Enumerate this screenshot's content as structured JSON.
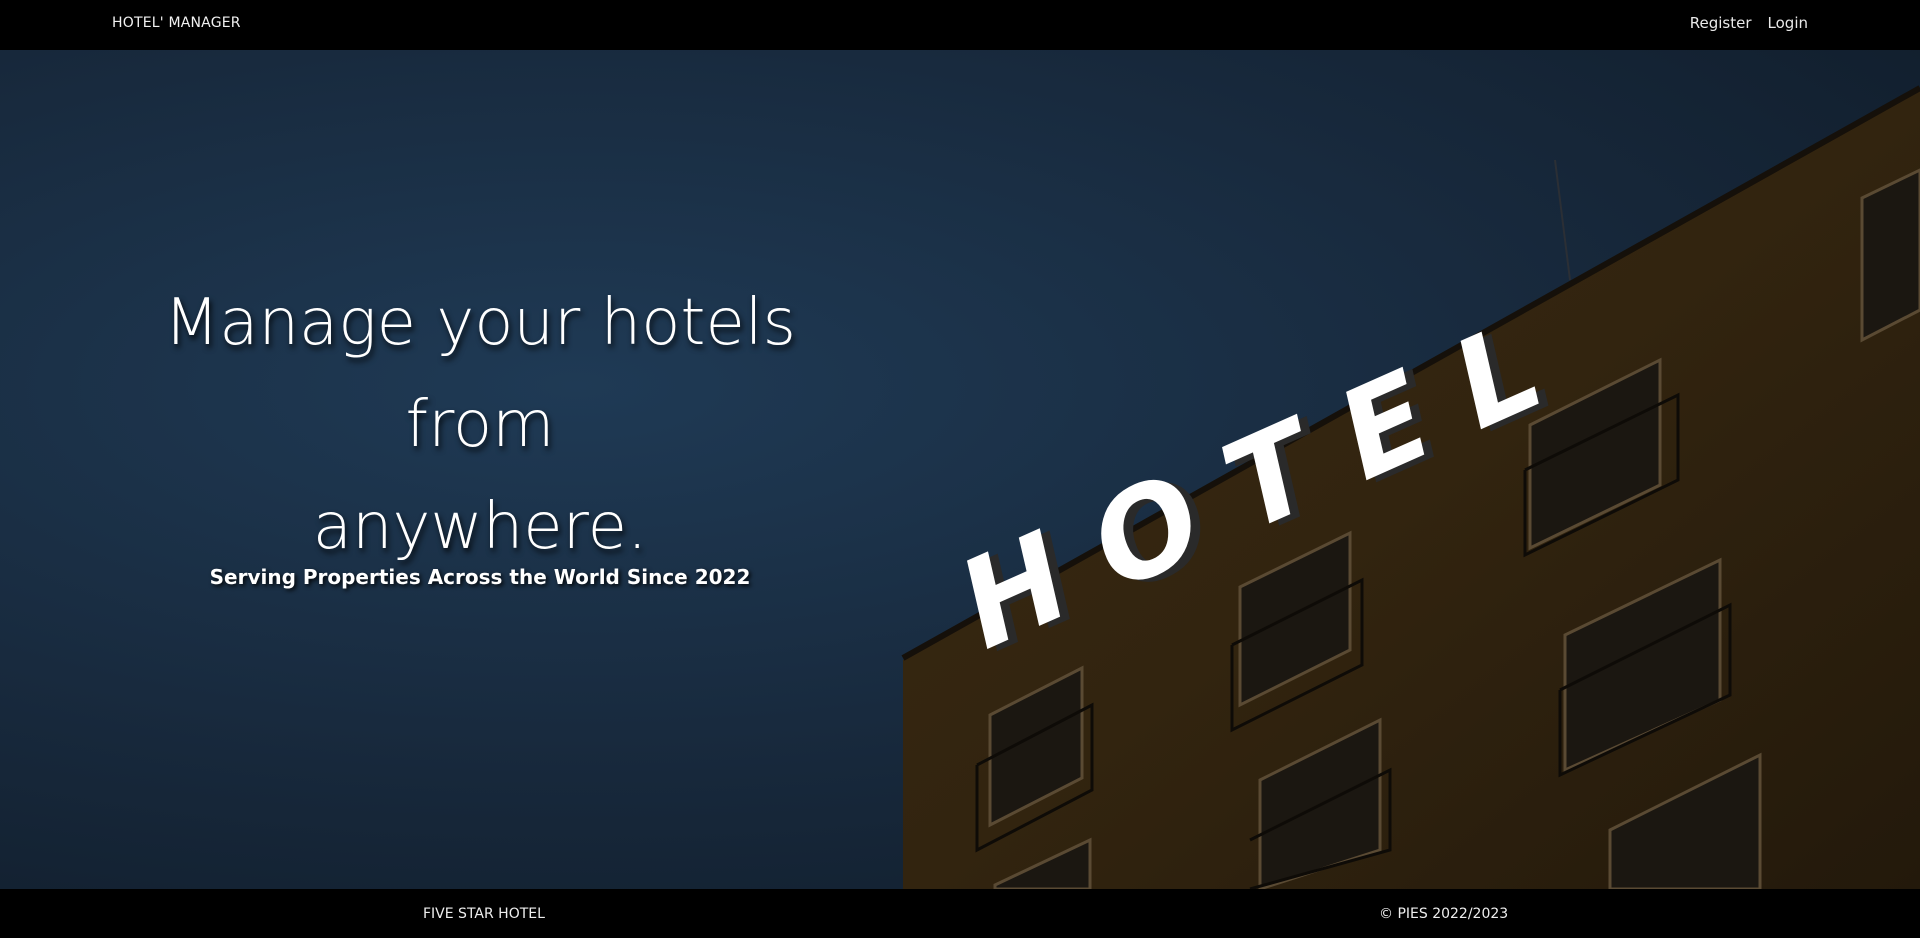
{
  "navbar": {
    "brand": "HOTEL' MANAGER",
    "links": [
      {
        "label": "Register"
      },
      {
        "label": "Login"
      }
    ]
  },
  "hero": {
    "title_line1": "Manage your hotels from",
    "title_line2": "anywhere.",
    "subtitle": "Serving Properties Across the World Since 2022",
    "sign_text": "HOTEL"
  },
  "footer": {
    "left": "FIVE STAR HOTEL",
    "right": "© PIES 2022/2023"
  }
}
